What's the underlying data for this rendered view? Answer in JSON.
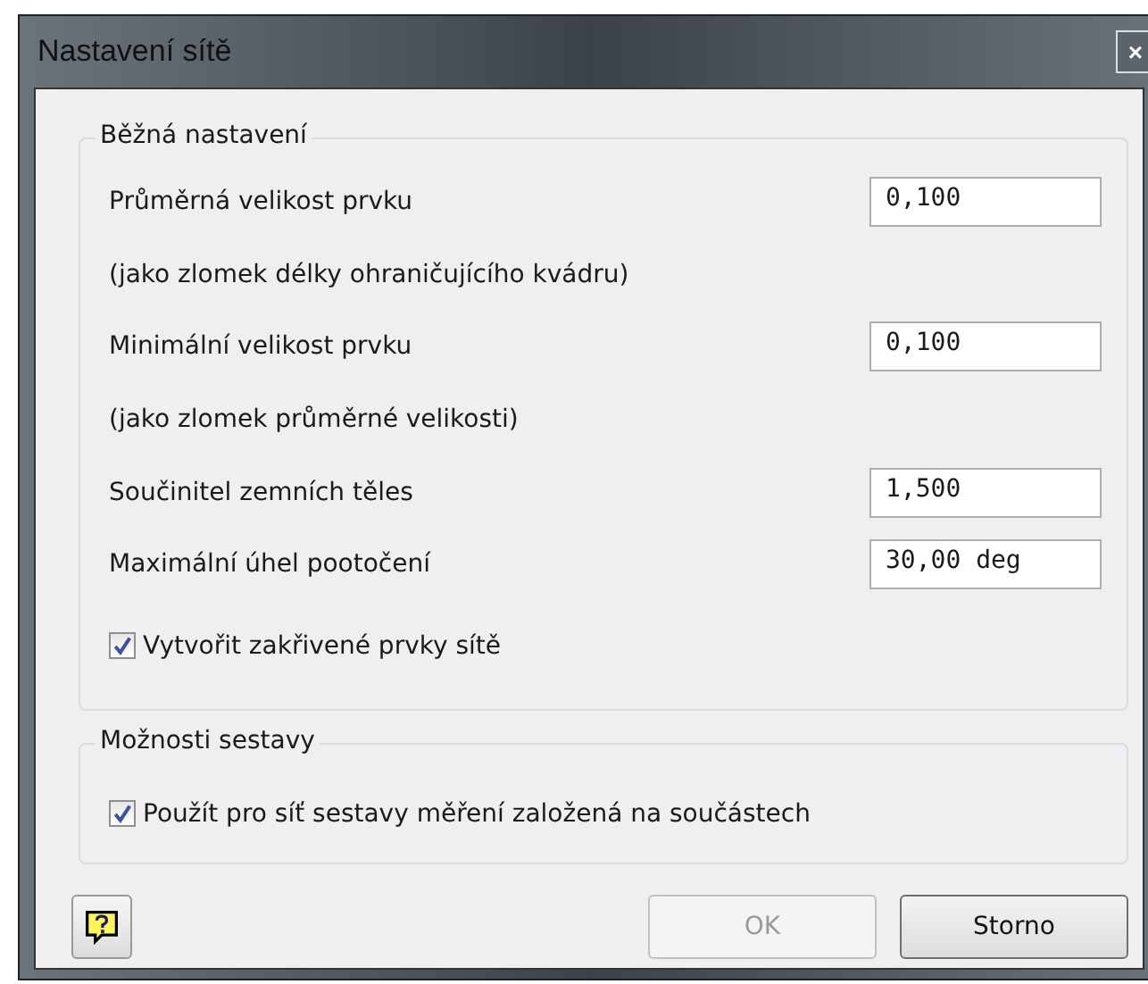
{
  "window": {
    "title": "Nastavení sítě",
    "close": "×"
  },
  "groups": [
    {
      "title": "Běžná nastavení",
      "items": [
        {
          "kind": "field",
          "label": "Průměrná velikost prvku",
          "value": "0,100"
        },
        {
          "kind": "note",
          "label": "(jako zlomek délky ohraničujícího kvádru)"
        },
        {
          "kind": "field",
          "label": "Minimální velikost prvku",
          "value": "0,100"
        },
        {
          "kind": "note",
          "label": "(jako zlomek průměrné velikosti)"
        },
        {
          "kind": "field",
          "label": "Součinitel zemních těles",
          "value": "1,500"
        },
        {
          "kind": "field",
          "label": "Maximální úhel pootočení",
          "value": "30,00 deg"
        },
        {
          "kind": "checkbox",
          "label": "Vytvořit zakřivené prvky sítě",
          "checked": true
        }
      ]
    },
    {
      "title": "Možnosti sestavy",
      "items": [
        {
          "kind": "checkbox",
          "label": "Použít pro síť sestavy měření založená na součástech",
          "checked": true
        }
      ]
    }
  ],
  "buttons": [
    {
      "label": "OK",
      "disabled": true
    },
    {
      "label": "Storno",
      "disabled": false
    }
  ]
}
